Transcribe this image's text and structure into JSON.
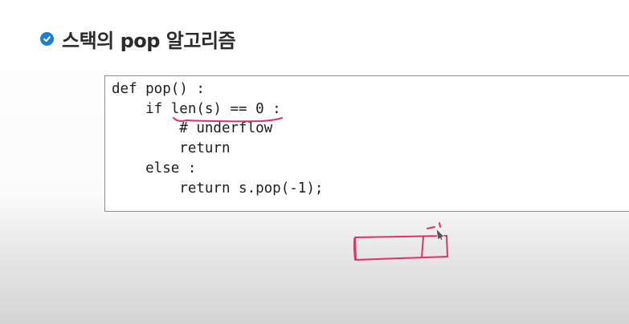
{
  "slide": {
    "title": "스택의 pop 알고리즘",
    "title_icon": "check-circle-icon",
    "accent_color": "#1e7fd0",
    "annotation_color": "#e0306e"
  },
  "code": {
    "lines": [
      "def pop() :",
      "    if len(s) == 0 :",
      "        # underflow",
      "        return",
      "    else :",
      "        return s.pop(-1);"
    ]
  }
}
